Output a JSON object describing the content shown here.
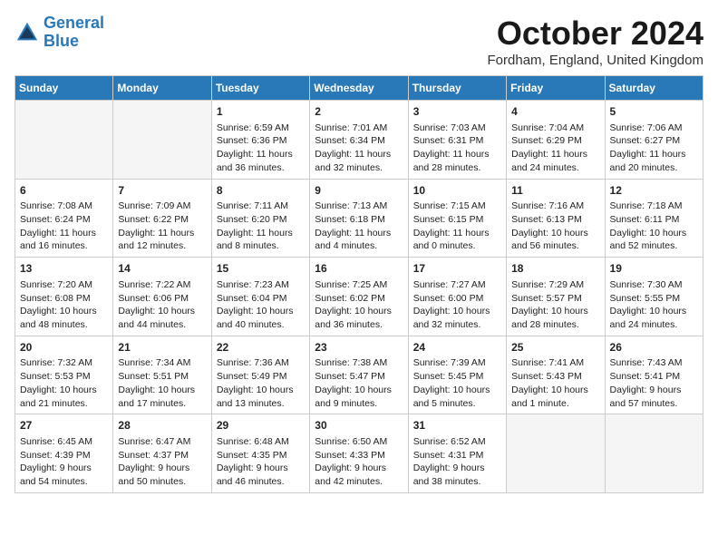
{
  "header": {
    "logo_line1": "General",
    "logo_line2": "Blue",
    "month": "October 2024",
    "location": "Fordham, England, United Kingdom"
  },
  "weekdays": [
    "Sunday",
    "Monday",
    "Tuesday",
    "Wednesday",
    "Thursday",
    "Friday",
    "Saturday"
  ],
  "weeks": [
    [
      {
        "day": "",
        "empty": true
      },
      {
        "day": "",
        "empty": true
      },
      {
        "day": "1",
        "info": "Sunrise: 6:59 AM\nSunset: 6:36 PM\nDaylight: 11 hours and 36 minutes."
      },
      {
        "day": "2",
        "info": "Sunrise: 7:01 AM\nSunset: 6:34 PM\nDaylight: 11 hours and 32 minutes."
      },
      {
        "day": "3",
        "info": "Sunrise: 7:03 AM\nSunset: 6:31 PM\nDaylight: 11 hours and 28 minutes."
      },
      {
        "day": "4",
        "info": "Sunrise: 7:04 AM\nSunset: 6:29 PM\nDaylight: 11 hours and 24 minutes."
      },
      {
        "day": "5",
        "info": "Sunrise: 7:06 AM\nSunset: 6:27 PM\nDaylight: 11 hours and 20 minutes."
      }
    ],
    [
      {
        "day": "6",
        "info": "Sunrise: 7:08 AM\nSunset: 6:24 PM\nDaylight: 11 hours and 16 minutes."
      },
      {
        "day": "7",
        "info": "Sunrise: 7:09 AM\nSunset: 6:22 PM\nDaylight: 11 hours and 12 minutes."
      },
      {
        "day": "8",
        "info": "Sunrise: 7:11 AM\nSunset: 6:20 PM\nDaylight: 11 hours and 8 minutes."
      },
      {
        "day": "9",
        "info": "Sunrise: 7:13 AM\nSunset: 6:18 PM\nDaylight: 11 hours and 4 minutes."
      },
      {
        "day": "10",
        "info": "Sunrise: 7:15 AM\nSunset: 6:15 PM\nDaylight: 11 hours and 0 minutes."
      },
      {
        "day": "11",
        "info": "Sunrise: 7:16 AM\nSunset: 6:13 PM\nDaylight: 10 hours and 56 minutes."
      },
      {
        "day": "12",
        "info": "Sunrise: 7:18 AM\nSunset: 6:11 PM\nDaylight: 10 hours and 52 minutes."
      }
    ],
    [
      {
        "day": "13",
        "info": "Sunrise: 7:20 AM\nSunset: 6:08 PM\nDaylight: 10 hours and 48 minutes."
      },
      {
        "day": "14",
        "info": "Sunrise: 7:22 AM\nSunset: 6:06 PM\nDaylight: 10 hours and 44 minutes."
      },
      {
        "day": "15",
        "info": "Sunrise: 7:23 AM\nSunset: 6:04 PM\nDaylight: 10 hours and 40 minutes."
      },
      {
        "day": "16",
        "info": "Sunrise: 7:25 AM\nSunset: 6:02 PM\nDaylight: 10 hours and 36 minutes."
      },
      {
        "day": "17",
        "info": "Sunrise: 7:27 AM\nSunset: 6:00 PM\nDaylight: 10 hours and 32 minutes."
      },
      {
        "day": "18",
        "info": "Sunrise: 7:29 AM\nSunset: 5:57 PM\nDaylight: 10 hours and 28 minutes."
      },
      {
        "day": "19",
        "info": "Sunrise: 7:30 AM\nSunset: 5:55 PM\nDaylight: 10 hours and 24 minutes."
      }
    ],
    [
      {
        "day": "20",
        "info": "Sunrise: 7:32 AM\nSunset: 5:53 PM\nDaylight: 10 hours and 21 minutes."
      },
      {
        "day": "21",
        "info": "Sunrise: 7:34 AM\nSunset: 5:51 PM\nDaylight: 10 hours and 17 minutes."
      },
      {
        "day": "22",
        "info": "Sunrise: 7:36 AM\nSunset: 5:49 PM\nDaylight: 10 hours and 13 minutes."
      },
      {
        "day": "23",
        "info": "Sunrise: 7:38 AM\nSunset: 5:47 PM\nDaylight: 10 hours and 9 minutes."
      },
      {
        "day": "24",
        "info": "Sunrise: 7:39 AM\nSunset: 5:45 PM\nDaylight: 10 hours and 5 minutes."
      },
      {
        "day": "25",
        "info": "Sunrise: 7:41 AM\nSunset: 5:43 PM\nDaylight: 10 hours and 1 minute."
      },
      {
        "day": "26",
        "info": "Sunrise: 7:43 AM\nSunset: 5:41 PM\nDaylight: 9 hours and 57 minutes."
      }
    ],
    [
      {
        "day": "27",
        "info": "Sunrise: 6:45 AM\nSunset: 4:39 PM\nDaylight: 9 hours and 54 minutes."
      },
      {
        "day": "28",
        "info": "Sunrise: 6:47 AM\nSunset: 4:37 PM\nDaylight: 9 hours and 50 minutes."
      },
      {
        "day": "29",
        "info": "Sunrise: 6:48 AM\nSunset: 4:35 PM\nDaylight: 9 hours and 46 minutes."
      },
      {
        "day": "30",
        "info": "Sunrise: 6:50 AM\nSunset: 4:33 PM\nDaylight: 9 hours and 42 minutes."
      },
      {
        "day": "31",
        "info": "Sunrise: 6:52 AM\nSunset: 4:31 PM\nDaylight: 9 hours and 38 minutes."
      },
      {
        "day": "",
        "empty": true
      },
      {
        "day": "",
        "empty": true
      }
    ]
  ]
}
